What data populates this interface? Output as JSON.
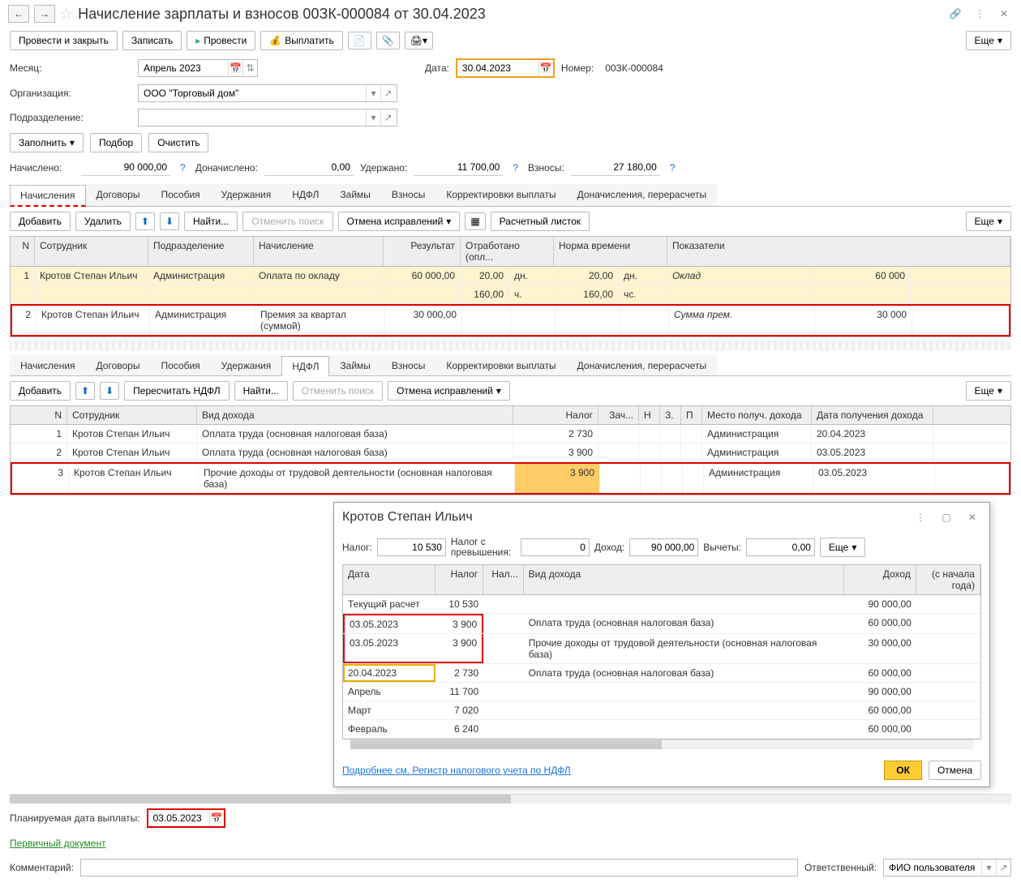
{
  "title": "Начисление зарплаты и взносов 00ЗК-000084 от 30.04.2023",
  "toolbar": {
    "post_close": "Провести и закрыть",
    "save": "Записать",
    "post": "Провести",
    "pay": "Выплатить",
    "more": "Еще"
  },
  "form": {
    "month_label": "Месяц:",
    "month": "Апрель 2023",
    "date_label": "Дата:",
    "date": "30.04.2023",
    "number_label": "Номер:",
    "number": "00ЗК-000084",
    "org_label": "Организация:",
    "org": "ООО \"Торговый дом\"",
    "dept_label": "Подразделение:",
    "dept": "",
    "fill": "Заполнить",
    "pick": "Подбор",
    "clear": "Очистить",
    "accrued_label": "Начислено:",
    "accrued": "90 000,00",
    "add_accrued_label": "Доначислено:",
    "add_accrued": "0,00",
    "withheld_label": "Удержано:",
    "withheld": "11 700,00",
    "contrib_label": "Взносы:",
    "contrib": "27 180,00"
  },
  "tabs": [
    "Начисления",
    "Договоры",
    "Пособия",
    "Удержания",
    "НДФЛ",
    "Займы",
    "Взносы",
    "Корректировки выплаты",
    "Доначисления, перерасчеты"
  ],
  "sub_toolbar": {
    "add": "Добавить",
    "delete": "Удалить",
    "find": "Найти...",
    "cancel_find": "Отменить поиск",
    "cancel_fix": "Отмена исправлений",
    "payslip": "Расчетный листок",
    "recalc_ndfl": "Пересчитать НДФЛ",
    "more": "Еще"
  },
  "grid1_headers": {
    "n": "N",
    "emp": "Сотрудник",
    "dept": "Подразделение",
    "accr": "Начисление",
    "res": "Результат",
    "work": "Отработано (опл...",
    "norm": "Норма времени",
    "ind": "Показатели"
  },
  "grid1": [
    {
      "n": "1",
      "emp": "Кротов Степан Ильич",
      "dept": "Администрация",
      "accr": "Оплата по окладу",
      "res": "60 000,00",
      "work_d": "20,00",
      "work_du": "дн.",
      "work_h": "160,00",
      "work_hu": "ч.",
      "norm_d": "20,00",
      "norm_du": "дн.",
      "norm_h": "160,00",
      "norm_hu": "чс.",
      "ind": "Оклад",
      "indval": "60 000"
    },
    {
      "n": "2",
      "emp": "Кротов Степан Ильич",
      "dept": "Администрация",
      "accr": "Премия за квартал (суммой)",
      "res": "30 000,00",
      "work_d": "",
      "work_du": "",
      "work_h": "",
      "work_hu": "",
      "norm_d": "",
      "norm_du": "",
      "norm_h": "",
      "norm_hu": "",
      "ind": "Сумма прем.",
      "indval": "30 000"
    }
  ],
  "grid2_headers": {
    "n": "N",
    "emp": "Сотрудник",
    "inc": "Вид дохода",
    "tax": "Налог",
    "zach": "Зач...",
    "h": "Н",
    "z": "З.",
    "p": "П",
    "place": "Место получ. дохода",
    "date": "Дата получения дохода"
  },
  "grid2": [
    {
      "n": "1",
      "emp": "Кротов Степан Ильич",
      "inc": "Оплата труда (основная налоговая база)",
      "tax": "2 730",
      "place": "Администрация",
      "date": "20.04.2023"
    },
    {
      "n": "2",
      "emp": "Кротов Степан Ильич",
      "inc": "Оплата труда (основная налоговая база)",
      "tax": "3 900",
      "place": "Администрация",
      "date": "03.05.2023"
    },
    {
      "n": "3",
      "emp": "Кротов Степан Ильич",
      "inc": "Прочие доходы от трудовой деятельности (основная налоговая база)",
      "tax": "3 900",
      "place": "Администрация",
      "date": "03.05.2023"
    }
  ],
  "popup": {
    "title": "Кротов Степан Ильич",
    "tax_label": "Налог:",
    "tax": "10 530",
    "excess_label": "Налог с превышения:",
    "excess": "0",
    "income_label": "Доход:",
    "income": "90 000,00",
    "deduct_label": "Вычеты:",
    "deduct": "0,00",
    "more": "Еще",
    "headers": {
      "date": "Дата",
      "tax": "Налог",
      "tax13": "Нал...",
      "type": "Вид дохода",
      "inc": "Доход",
      "year": "(с начала года)"
    },
    "rows": [
      {
        "date": "Текущий расчет",
        "tax": "10 530",
        "type": "",
        "inc": "90 000,00",
        "cls": "gray"
      },
      {
        "date": "03.05.2023",
        "tax": "3 900",
        "type": "Оплата труда (основная налоговая база)",
        "inc": "60 000,00"
      },
      {
        "date": "03.05.2023",
        "tax": "3 900",
        "type": "Прочие доходы от трудовой деятельности (основная налоговая база)",
        "inc": "30 000,00"
      },
      {
        "date": "20.04.2023",
        "tax": "2 730",
        "type": "Оплата труда (основная налоговая база)",
        "inc": "60 000,00",
        "cls": "highlight-yellow"
      },
      {
        "date": "Апрель",
        "tax": "11 700",
        "type": "",
        "inc": "90 000,00",
        "cls": "gray"
      },
      {
        "date": "Март",
        "tax": "7 020",
        "type": "",
        "inc": "60 000,00",
        "cls": "gray"
      },
      {
        "date": "Февраль",
        "tax": "6 240",
        "type": "",
        "inc": "60 000,00",
        "cls": "gray"
      }
    ],
    "link": "Подробнее см. Регистр налогового учета по НДФЛ",
    "ok": "ОК",
    "cancel": "Отмена"
  },
  "footer": {
    "plan_date_label": "Планируемая дата выплаты:",
    "plan_date": "03.05.2023",
    "primary_doc": "Первичный документ",
    "comment_label": "Комментарий:",
    "comment": "",
    "resp_label": "Ответственный:",
    "resp": "ФИО пользователя"
  }
}
